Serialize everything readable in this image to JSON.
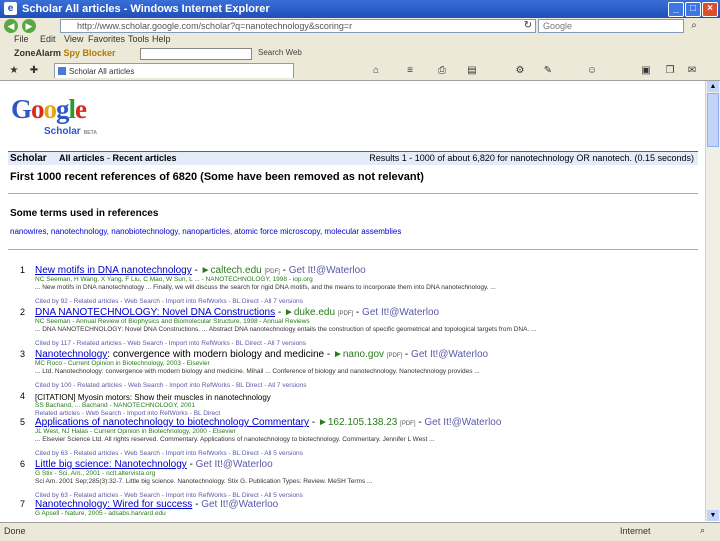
{
  "window": {
    "title": "Scholar All articles - Windows Internet Explorer",
    "minimize": "_",
    "maximize": "□",
    "close": "×"
  },
  "address": {
    "url": "http://www.scholar.google.com/scholar?q=nanotechnology&scoring=r",
    "search_placeholder": "Google"
  },
  "menu": [
    "File",
    "Edit",
    "View",
    "Favorites",
    "Tools",
    "Help"
  ],
  "toolbar2": {
    "brand": "ZoneAlarm",
    "brand_sub": "Spy Blocker",
    "search_label": "Search Web"
  },
  "tab": {
    "label": "Scholar All articles"
  },
  "logo": {
    "sub": "Scholar",
    "beta": "BETA"
  },
  "scholar_bar": {
    "label": "Scholar",
    "crumb_all": "All articles",
    "crumb_sep": " - ",
    "crumb_recent": "Recent articles",
    "results": "Results 1 - 1000 of about 6,820 for nanotechnology OR nanotech. (0.15 seconds)"
  },
  "notice": "First 1000 recent references of 6820 (Some have been removed as not relevant)",
  "terms_heading": "Some terms used in references",
  "terms": "nanowires, nanotechnology, nanobiotechnology, nanoparticles, atomic force microscopy, molecular assemblies",
  "results": [
    {
      "num": "1",
      "title": "New motifs in DNA nanotechnology",
      "source": "caltech.edu",
      "tag": "[PDF]",
      "extra": "Get It!@Waterloo",
      "authors": "NC Seeman, H Wang, X Yang, F Liu, C Mao, W Sun, L ... - NANOTECHNOLOGY, 1998 - iop.org",
      "snippet": "... New motifs in DNA nanotechnology ... Finally, we will discuss the search for rigid DNA motifs, and the means to incorporate them into DNA nanotechnology. ...",
      "links": "Cited by 92 - Related articles - Web Search - Import into RefWorks - BL Direct - All 7 versions"
    },
    {
      "num": "2",
      "title": "DNA NANOTECHNOLOGY: Novel DNA Constructions",
      "source": "duke.edu",
      "tag": "[PDF]",
      "extra": "Get It!@Waterloo",
      "authors": "NC Seeman - Annual Review of Biophysics and Biomolecular Structure, 1998 - Annual Reviews",
      "snippet": "... DNA NANOTECHNOLOGY: Novel DNA Constructions. ... Abstract DNA nanotechnology entails the construction of specific geometrical and topological targets from DNA. ...",
      "links": "Cited by 117 - Related articles - Web Search - Import into RefWorks - BL Direct - All 7 versions"
    },
    {
      "num": "3",
      "title": "Nanotechnology",
      "title_rest": ": convergence with modern biology and medicine",
      "source": "nano.gov",
      "tag": "[PDF]",
      "extra": "Get It!@Waterloo",
      "authors": "MC Roco - Current Opinion in Biotechnology, 2003 - Elsevier",
      "snippet": "... Ltd. Nanotechnology: convergence with modern biology and medicine. Mihail ... Conference of biology and nanotechnology. Nanotechnology provides ...",
      "links": "Cited by 100 - Related articles - Web Search - Import into RefWorks - BL Direct - All 7 versions"
    },
    {
      "num": "4",
      "title_plain": "[CITATION] Myosin motors: Show their muscles in nanotechnology",
      "authors": "SS Bachand, ... Bachand - NANOTECHNOLOGY, 2001",
      "links": "Related articles - Web Search - Import into RefWorks - BL Direct"
    },
    {
      "num": "5",
      "title": "Applications of nanotechnology to biotechnology Commentary",
      "source": "162.105.138.23",
      "tag": "[PDF]",
      "extra": "Get It!@Waterloo",
      "authors": "JL West, NJ Halas - Current Opinion in Biotechnology, 2000 - Elsevier",
      "snippet": "... Elsevier Science Ltd. All rights reserved. Commentary. Applications of nanotechnology to biotechnology. Commentary. Jennifer L West ...",
      "links": "Cited by 63 - Related articles - Web Search - Import into RefWorks - BL Direct - All 5 versions"
    },
    {
      "num": "6",
      "title": "Little big science: Nanotechnology",
      "extra": "Get It!@Waterloo",
      "authors": "G Stix - Sci. Am., 2001 - nclt.altervista.org",
      "snippet": "Sci Am. 2001 Sep;285(3):32-7. Little big science. Nanotechnology. Stix G. Publication Types: Review. MeSH Terms ...",
      "links": "Cited by 63 - Related articles - Web Search - Import into RefWorks - BL Direct - All 5 versions"
    },
    {
      "num": "7",
      "title": "Nanotechnology: Wired for success",
      "extra": "Get It!@Waterloo",
      "authors": "G Apsell - Nature, 2005 - adsabs.harvard.edu",
      "snippet": "",
      "links": ""
    }
  ],
  "status": {
    "left": "Done",
    "right": "Internet"
  }
}
